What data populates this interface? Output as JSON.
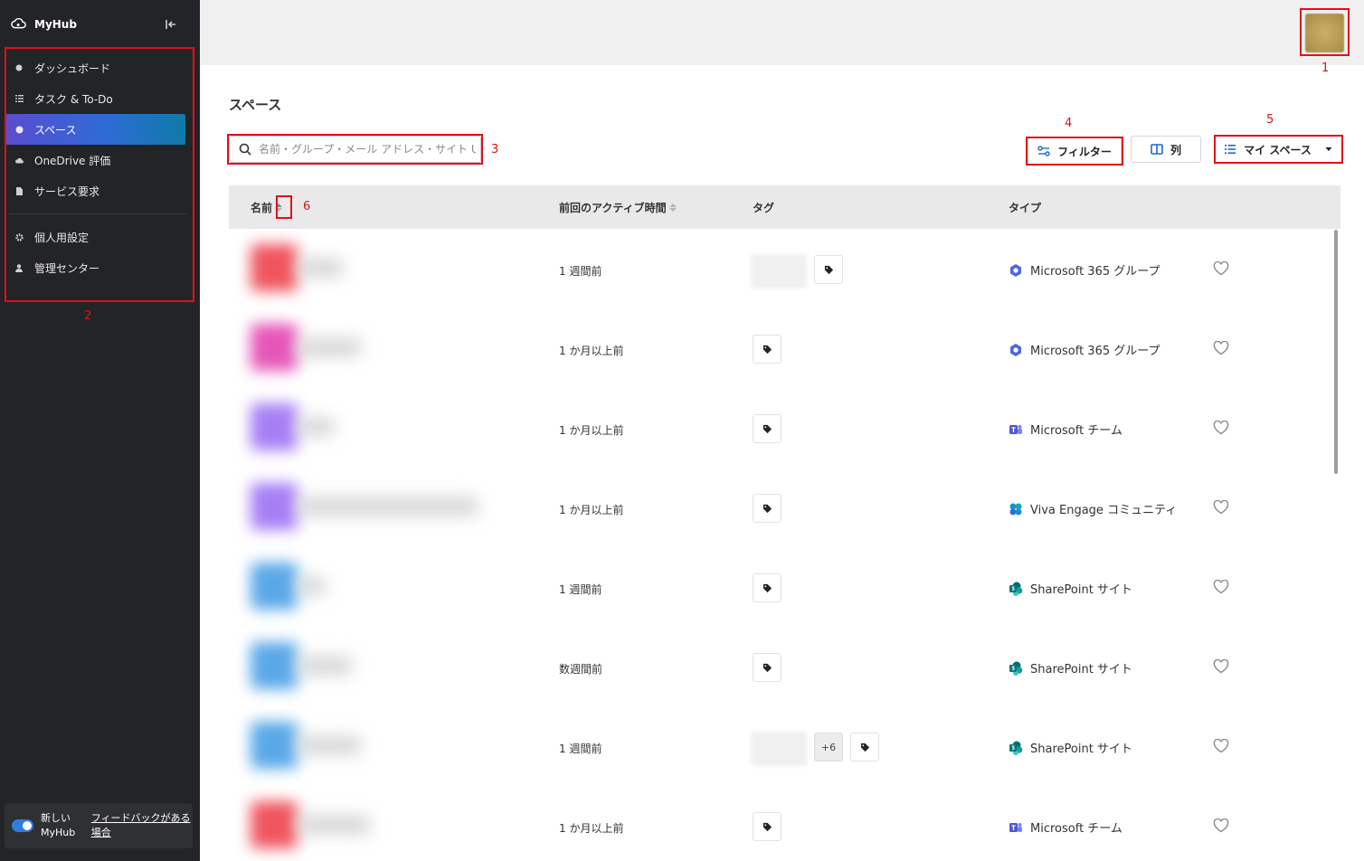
{
  "app": {
    "name": "MyHub"
  },
  "sidebar": {
    "items": [
      {
        "label": "ダッシュボード",
        "icon": "dashboard-icon"
      },
      {
        "label": "タスク & To-Do",
        "icon": "list-icon"
      },
      {
        "label": "スペース",
        "icon": "globe-icon",
        "active": true
      },
      {
        "label": "OneDrive 評価",
        "icon": "cloud-icon"
      },
      {
        "label": "サービス要求",
        "icon": "document-icon"
      },
      {
        "label": "個人用設定",
        "icon": "gear-icon"
      },
      {
        "label": "管理センター",
        "icon": "person-icon"
      }
    ],
    "footer": {
      "toggle_label": "新しい MyHub",
      "feedback_link": "フィードバックがある場合"
    }
  },
  "main": {
    "title": "スペース",
    "search": {
      "placeholder": "名前・グループ・メール アドレス・サイト URL..."
    },
    "filter_button": "フィルター",
    "columns_button": "列",
    "view_select": "マイ スペース"
  },
  "table": {
    "headers": {
      "name": "名前",
      "last_active": "前回のアクティブ時間",
      "tags": "タグ",
      "type": "タイプ"
    },
    "rows": [
      {
        "last_active": "1 週間前",
        "type": "Microsoft 365 グループ",
        "type_icon": "m365-group-icon",
        "avatar_color": "#f0555f",
        "has_tag_chip": true,
        "more": ""
      },
      {
        "last_active": "1 か月以上前",
        "type": "Microsoft 365 グループ",
        "type_icon": "m365-group-icon",
        "avatar_color": "#e656b9",
        "has_tag_chip": false,
        "more": ""
      },
      {
        "last_active": "1 か月以上前",
        "type": "Microsoft チーム",
        "type_icon": "teams-icon",
        "avatar_color": "#a77ff5",
        "has_tag_chip": false,
        "more": ""
      },
      {
        "last_active": "1 か月以上前",
        "type": "Viva Engage コミュニティ",
        "type_icon": "viva-engage-icon",
        "avatar_color": "#a77ff5",
        "has_tag_chip": false,
        "more": ""
      },
      {
        "last_active": "1 週間前",
        "type": "SharePoint サイト",
        "type_icon": "sharepoint-icon",
        "avatar_color": "#5aa8e8",
        "has_tag_chip": false,
        "more": ""
      },
      {
        "last_active": "数週間前",
        "type": "SharePoint サイト",
        "type_icon": "sharepoint-icon",
        "avatar_color": "#5aa8e8",
        "has_tag_chip": false,
        "more": ""
      },
      {
        "last_active": "1 週間前",
        "type": "SharePoint サイト",
        "type_icon": "sharepoint-icon",
        "avatar_color": "#5aa8e8",
        "has_tag_chip": true,
        "more": "+6"
      },
      {
        "last_active": "1 か月以上前",
        "type": "Microsoft チーム",
        "type_icon": "teams-icon",
        "avatar_color": "#f0555f",
        "has_tag_chip": false,
        "more": ""
      }
    ]
  },
  "annotations": [
    "1",
    "2",
    "3",
    "4",
    "5",
    "6"
  ]
}
